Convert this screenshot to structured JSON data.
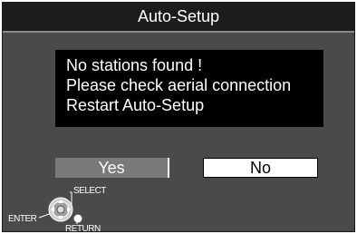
{
  "dialog": {
    "title": "Auto-Setup",
    "message_lines": [
      "No stations found !",
      "Please check aerial connection",
      "Restart Auto-Setup"
    ]
  },
  "buttons": {
    "yes_label": "Yes",
    "no_label": "No",
    "selected": "No"
  },
  "remote_legend": {
    "select_label": "SELECT",
    "enter_label": "ENTER",
    "return_label": "RETURN",
    "icons": [
      "dpad-icon",
      "return-button-icon"
    ]
  }
}
